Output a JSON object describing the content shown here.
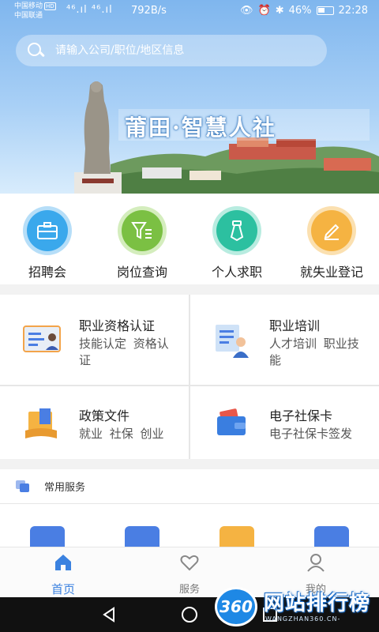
{
  "status_bar": {
    "carrier1": "中国移动",
    "carrier1_badge": "HD",
    "carrier2": "中国联通",
    "signal": "⁴⁶.ıl ⁴⁶.ıl",
    "speed": "792B/s",
    "battery": "46%",
    "time": "22:28"
  },
  "search": {
    "placeholder": "请输入公司/职位/地区信息"
  },
  "banner": {
    "title": "莆田·智慧人社"
  },
  "quick_menu": [
    {
      "label": "招聘会",
      "icon": "briefcase-icon",
      "color": "#3aa8ec"
    },
    {
      "label": "岗位查询",
      "icon": "filter-icon",
      "color": "#7bc043"
    },
    {
      "label": "个人求职",
      "icon": "tie-icon",
      "color": "#2cc0a0"
    },
    {
      "label": "就失业登记",
      "icon": "pencil-icon",
      "color": "#f5b342"
    }
  ],
  "services": [
    {
      "title": "职业资格认证",
      "subtitle": "技能认定 资格认证",
      "icon": "id-card-icon"
    },
    {
      "title": "职业培训",
      "subtitle": "人才培训 职业技能",
      "icon": "trainer-icon"
    },
    {
      "title": "政策文件",
      "subtitle": "就业 社保 创业",
      "icon": "folder-book-icon"
    },
    {
      "title": "电子社保卡",
      "subtitle": "电子社保卡签发",
      "icon": "wallet-card-icon"
    }
  ],
  "common_services": {
    "title": "常用服务",
    "items": [
      {
        "icon": "user-add-icon",
        "color": "#4a7ee3"
      },
      {
        "icon": "notepad-icon",
        "color": "#4a7ee3"
      },
      {
        "icon": "user-badge-icon",
        "color": "#f5b342"
      },
      {
        "icon": "document-icon",
        "color": "#4a7ee3"
      }
    ]
  },
  "tabs": [
    {
      "label": "首页",
      "icon": "home-icon",
      "active": true
    },
    {
      "label": "服务",
      "icon": "heart-icon",
      "active": false
    },
    {
      "label": "我的",
      "icon": "person-icon",
      "active": false
    }
  ],
  "watermark": {
    "badge": "360",
    "text": "网站排行榜",
    "sub": "WANGZHAN360.CN-"
  }
}
